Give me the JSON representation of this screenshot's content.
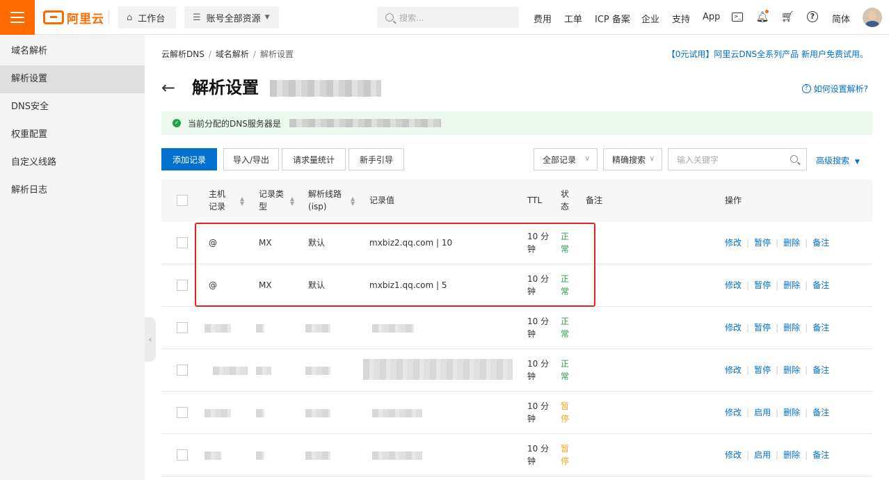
{
  "topbar": {
    "brand": "阿里云",
    "workbench": "工作台",
    "resources": "账号全部资源",
    "search_placeholder": "搜索...",
    "nav": [
      "费用",
      "工单",
      "ICP 备案",
      "企业",
      "支持",
      "App"
    ],
    "lang": "简体",
    "accent_color": "#ff6a00"
  },
  "sidebar": {
    "items": [
      {
        "label": "域名解析"
      },
      {
        "label": "解析设置"
      },
      {
        "label": "DNS安全"
      },
      {
        "label": "权重配置"
      },
      {
        "label": "自定义线路"
      },
      {
        "label": "解析日志"
      }
    ]
  },
  "breadcrumb": [
    "云解析DNS",
    "域名解析",
    "解析设置"
  ],
  "promo": "【0元试用】阿里云DNS全系列产品 新用户免费试用。",
  "page_title": "解析设置",
  "help_link": "如何设置解析?",
  "notice": "当前分配的DNS服务器是",
  "toolbar": {
    "add": "添加记录",
    "import_export": "导入/导出",
    "stats": "请求量统计",
    "guide": "新手引导",
    "filter": "全部记录",
    "search_mode": "精确搜索",
    "keyword_placeholder": "输入关键字",
    "advanced": "高级搜索"
  },
  "table": {
    "headers": {
      "host": "主机记录",
      "type": "记录类型",
      "line": "解析线路(isp)",
      "value": "记录值",
      "ttl": "TTL",
      "status": "状态",
      "remark": "备注",
      "ops": "操作"
    },
    "rows": [
      {
        "host": "@",
        "type": "MX",
        "line": "默认",
        "value": "mxbiz2.qq.com | 10",
        "ttl": "10 分钟",
        "status": "正常",
        "toggle": "暂停"
      },
      {
        "host": "@",
        "type": "MX",
        "line": "默认",
        "value": "mxbiz1.qq.com | 5",
        "ttl": "10 分钟",
        "status": "正常",
        "toggle": "暂停"
      },
      {
        "host": "",
        "type": "",
        "line": "",
        "value": "",
        "ttl": "10 分钟",
        "status": "正常",
        "toggle": "暂停"
      },
      {
        "host": "",
        "type": "",
        "line": "",
        "value": "",
        "ttl": "10 分钟",
        "status": "正常",
        "toggle": "暂停"
      },
      {
        "host": "",
        "type": "",
        "line": "",
        "value": "",
        "ttl": "10 分钟",
        "status": "暂停",
        "toggle": "启用"
      },
      {
        "host": "",
        "type": "",
        "line": "",
        "value": "",
        "ttl": "10 分钟",
        "status": "暂停",
        "toggle": "启用"
      }
    ],
    "op_labels": {
      "edit": "修改",
      "delete": "删除",
      "remark": "备注"
    }
  },
  "colors": {
    "link": "#0070cc",
    "ok": "#1fa34a",
    "paused": "#f5a623",
    "highlight": "#e52021"
  }
}
